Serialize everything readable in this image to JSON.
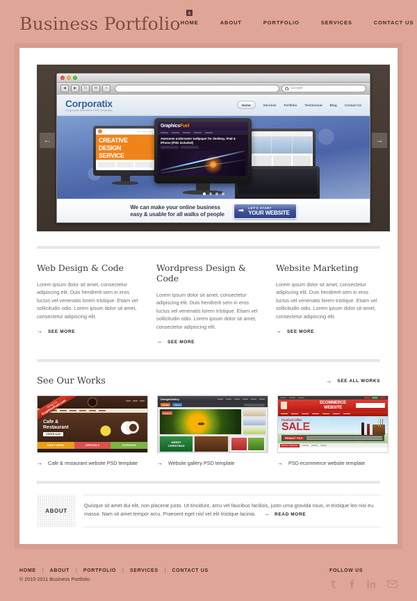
{
  "header": {
    "logo": "Business Portfolio",
    "nav": [
      {
        "label": "HOME",
        "badge": "download-icon"
      },
      {
        "label": "ABOUT"
      },
      {
        "label": "PORTFOLIO"
      },
      {
        "label": "SERVICES"
      },
      {
        "label": "CONTACT US"
      }
    ]
  },
  "slider": {
    "prev_arrow": "←",
    "next_arrow": "→",
    "browser": {
      "back": "◀",
      "forward": "▶",
      "reload": "↻",
      "bookmark": "✉",
      "add": "+",
      "url_value": "",
      "search_placeholder": "Google"
    },
    "site": {
      "brand": "Corporatix",
      "tagline": "Corporate Business PSD Template",
      "nav": [
        "Home",
        "Services",
        "Portfolio",
        "Testimonial",
        "Blog",
        "Contact Us"
      ],
      "active_nav": "Home",
      "monitor_left": {
        "line1": "CREATIVE",
        "line2": "DESIGN",
        "line3": "SERVICE"
      },
      "monitor_center": {
        "brand_a": "Graphics",
        "brand_b": "Fuel",
        "headline": "Awesome underwater wallpaper for desktop, iPad & iPhone (PSD included)"
      },
      "dots": 4,
      "active_dot": 1,
      "cta_line1": "We can make your online business",
      "cta_line2": "easy & usable for all walks of people",
      "cta_button_top": "LET'S START",
      "cta_button_bottom": "YOUR WEBSITE",
      "cta_button_arrow": "➡"
    }
  },
  "services": [
    {
      "title": "Web Design & Code",
      "body": "Lorem ipsum dolor sit amet, consectetur adipiscing elit. Duis hendrerit sem in eros luctus vel venenatis lorem tristique. Etiam vel sollicitudin odio. Lorem ipsum dolor sit amet, consectetur adipiscing elit.",
      "link": "SEE MORE",
      "arrow": "→"
    },
    {
      "title": "Wordpress Design & Code",
      "body": "Lorem ipsum dolor sit amet, consectetur adipiscing elit. Duis hendrerit sem in eros luctus vel venenatis lorem tristique. Etiam vel sollicitudin odio. Lorem ipsum dolor sit amet, consectetur adipiscing elit.",
      "link": "SEE MORE",
      "arrow": "→"
    },
    {
      "title": "Website Marketing",
      "body": "Lorem ipsum dolor sit amet, consectetur adipiscing elit. Duis hendrerit sem in eros luctus vel venenatis lorem tristique. Etiam vel sollicitudin odio. Lorem ipsum dolor sit amet, consectetur adipiscing elit.",
      "link": "SEE MORE",
      "arrow": "→"
    }
  ],
  "works": {
    "title": "See Our Works",
    "see_all": "SEE ALL WORKS",
    "arrow": "→",
    "items": [
      {
        "caption": "Cafe & restaurant website PSD template",
        "arrow": "→",
        "ribbon_line1": "Design by",
        "ribbon_line2": "GraphicsFuel.com",
        "shot": {
          "phone": "123-456-7890",
          "title_line1": "Cafe &",
          "title_line2": "Restaurant",
          "button": "ORDER NOW",
          "bars": [
            "DAILY MENU",
            "SPECIALS",
            "CATERING"
          ]
        }
      },
      {
        "caption": "Website gallery PSD template",
        "arrow": "→",
        "shot": {
          "brand": "DesignGallery",
          "tag1": "Photos",
          "tag2": "Videos",
          "featured": "Featured",
          "card1_line1": "MERRY",
          "card1_line2": "CHRISTMAS"
        }
      },
      {
        "caption": "PSD ecommerce website template",
        "arrow": "→",
        "shot": {
          "title_line1": "ECOMMERCE",
          "title_line2": "WEBSITE",
          "offer": "Festival Offer",
          "sale": "SALE",
          "product_title": "PRODUCT TITLE",
          "browse": "Browse Categories"
        }
      }
    ]
  },
  "about": {
    "badge": "ABOUT",
    "text": "Quisque sit amet dui elit, non placerat justo. Ut tincidunt, arcu vel faucibus facilisis, justo urna gravida risus, in tristique leo nisi eu massa. Nam sit amet tempor arcu. Praesent eget nisl vel elit tristique lacinia.",
    "read_more": "READ MORE",
    "arrow": "→"
  },
  "footer": {
    "nav": [
      "HOME",
      "ABOUT",
      "PORTFOLIO",
      "SERVICES",
      "CONTACT US"
    ],
    "separator": "|",
    "copyright": "© 2010-2011 Business Portfolio.",
    "follow_label": "FOLLOW US",
    "socials": [
      "twitter-icon",
      "facebook-icon",
      "linkedin-icon",
      "email-icon"
    ]
  },
  "colors": {
    "background": "#dfa596",
    "frame": "#d79c8d",
    "panel": "#ffffff",
    "logo": "#7e4a41",
    "accent_blue": "#3a5f9e",
    "divider": "#e6e6e6"
  }
}
